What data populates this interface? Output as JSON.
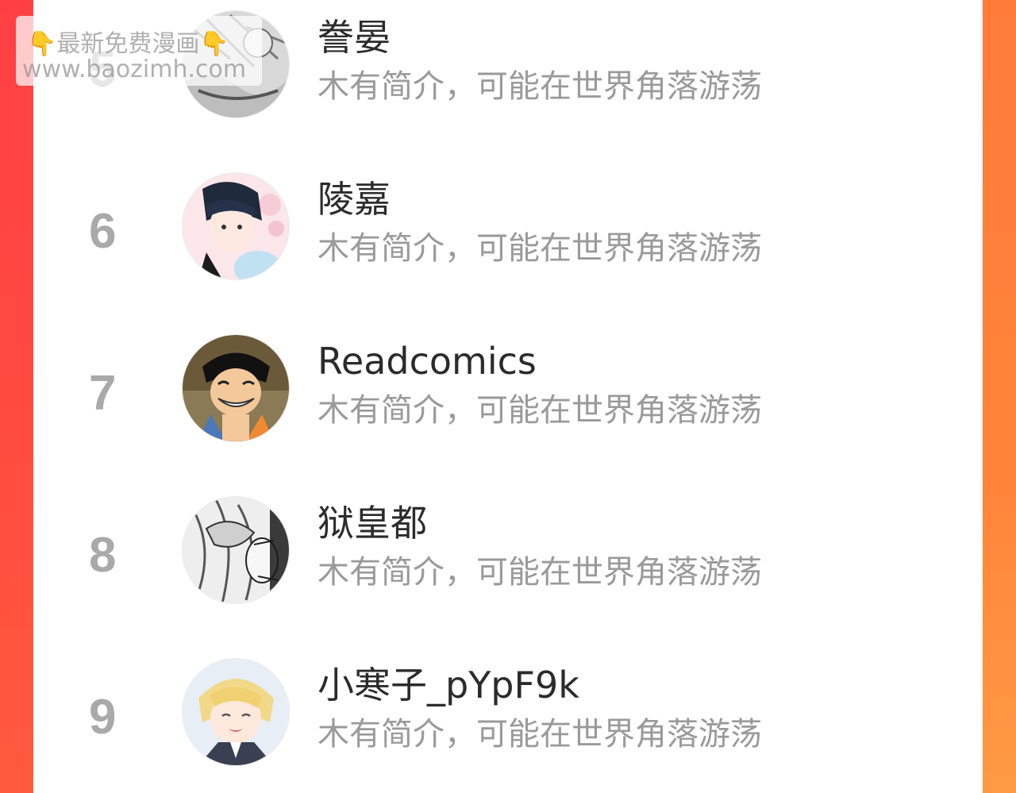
{
  "watermark": {
    "line1_icon_left": "👇",
    "line1_text": "最新免费漫画",
    "line1_icon_right": "👇",
    "line2_text": "www.baozimh.com"
  },
  "ranking": {
    "rows": [
      {
        "rank": "5",
        "name": "誊晏",
        "bio": "木有简介，可能在世界角落游荡",
        "avatar_icon": "manga-sketch-avatar"
      },
      {
        "rank": "6",
        "name": "陵嘉",
        "bio": "木有简介，可能在世界角落游荡",
        "avatar_icon": "anime-boy-avatar"
      },
      {
        "rank": "7",
        "name": "Readcomics",
        "bio": "木有简介，可能在世界角落游荡",
        "avatar_icon": "straw-hat-avatar"
      },
      {
        "rank": "8",
        "name": "狱皇都",
        "bio": "木有简介，可能在世界角落游荡",
        "avatar_icon": "ink-sketch-avatar"
      },
      {
        "rank": "9",
        "name": "小寒子_pYpF9k",
        "bio": "木有简介，可能在世界角落游荡",
        "avatar_icon": "blonde-anime-avatar"
      }
    ]
  }
}
